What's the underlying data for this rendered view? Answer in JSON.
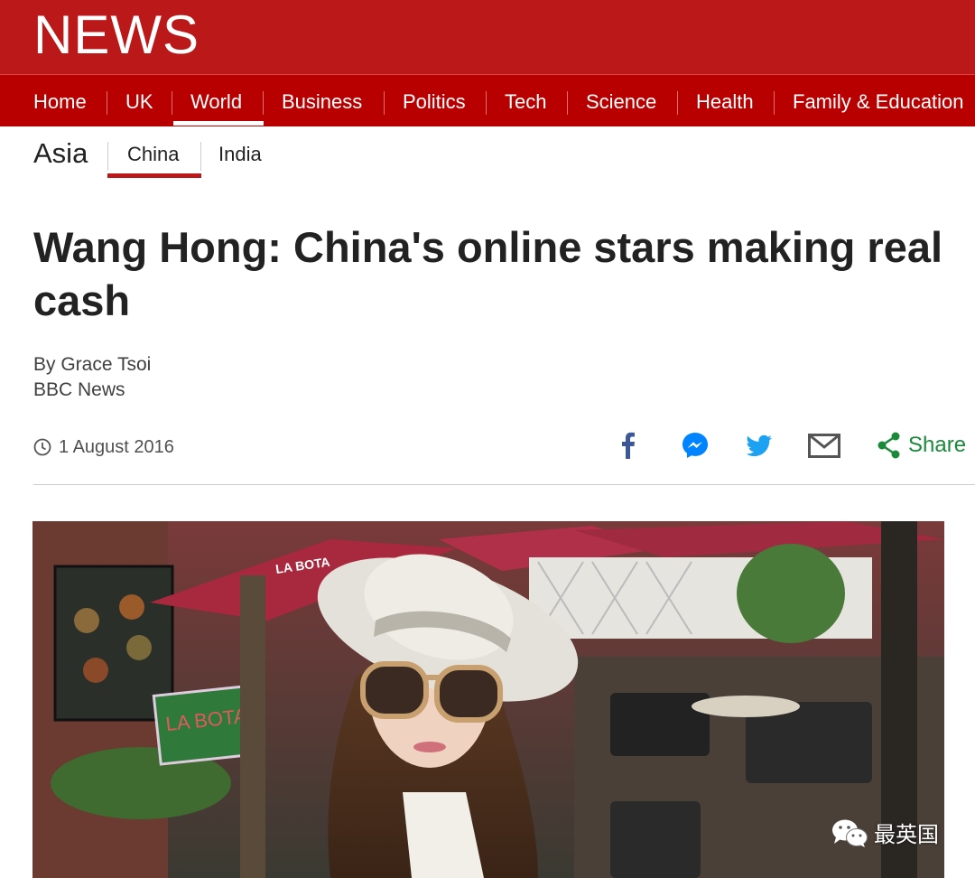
{
  "masthead": {
    "logo": "NEWS"
  },
  "nav": {
    "items": [
      "Home",
      "UK",
      "World",
      "Business",
      "Politics",
      "Tech",
      "Science",
      "Health",
      "Family & Education"
    ],
    "active": "World"
  },
  "subnav": {
    "section": "Asia",
    "items": [
      "China",
      "India"
    ],
    "active": "China"
  },
  "article": {
    "headline": "Wang Hong: China's online stars making real cash",
    "byline": "By Grace Tsoi",
    "source": "BBC News",
    "date": "1 August 2016"
  },
  "share": {
    "icons": [
      "facebook-icon",
      "messenger-icon",
      "twitter-icon",
      "email-icon",
      "share-icon"
    ],
    "label": "Share"
  },
  "photo": {
    "sign_umbrella": "LA BOTA",
    "sign_board": "LA BOTA"
  },
  "watermark": {
    "text": "最英国"
  },
  "colors": {
    "brand": "#bb1919",
    "nav": "#b80000",
    "share": "#1a8a3a"
  }
}
